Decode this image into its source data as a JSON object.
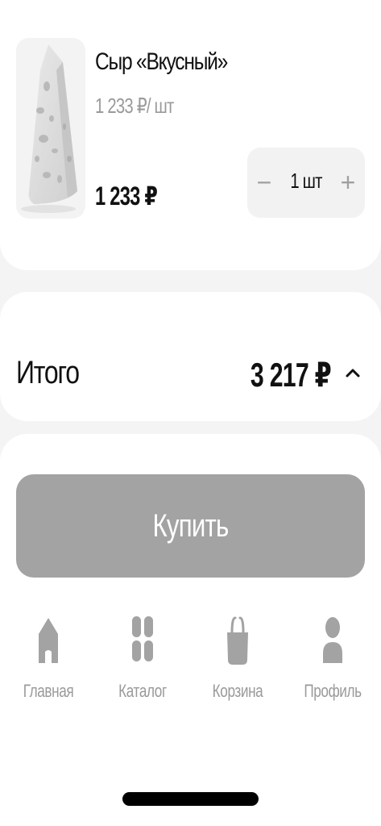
{
  "product": {
    "name": "Сыр «Вкусный»",
    "unit_price": "1 233 ₽/ шт",
    "price": "1 233 ₽",
    "quantity": "1 шт",
    "minus": "−",
    "plus": "+"
  },
  "summary": {
    "total_label": "Итого",
    "total_value": "3 217 ₽"
  },
  "buy_label": "Купить",
  "tabs": [
    {
      "label": "Главная",
      "icon": "home-icon"
    },
    {
      "label": "Каталог",
      "icon": "catalog-grid-icon"
    },
    {
      "label": "Корзина",
      "icon": "basket-icon"
    },
    {
      "label": "Профиль",
      "icon": "profile-icon"
    }
  ],
  "colors": {
    "background": "#f4f4f4",
    "card": "#ffffff",
    "button": "#a3a3a3",
    "muted_text": "#9a9a9a",
    "icon": "#a3a3a3"
  }
}
